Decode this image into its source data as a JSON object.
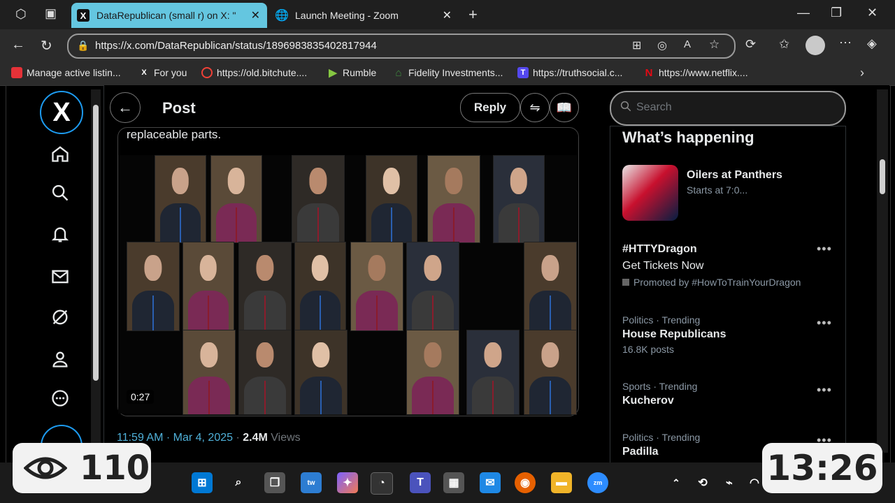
{
  "browser": {
    "tabs": [
      {
        "label": "DataRepublican (small r) on X: \"",
        "favicon": "X",
        "active": true
      },
      {
        "label": "Launch Meeting - Zoom",
        "favicon": "globe",
        "active": false
      }
    ],
    "url": "https://x.com/DataRepublican/status/1896983835402817944",
    "bookmarks": [
      {
        "label": "Manage active listin...",
        "icon": "ebay-icon",
        "color": "#e53238"
      },
      {
        "label": "For you",
        "icon": "x-icon",
        "color": "#000000"
      },
      {
        "label": "https://old.bitchute....",
        "icon": "bitchute-icon",
        "color": "#ef4137"
      },
      {
        "label": "Rumble",
        "icon": "rumble-icon",
        "color": "#85c742"
      },
      {
        "label": "Fidelity Investments...",
        "icon": "fidelity-icon",
        "color": "#3f8d3f"
      },
      {
        "label": "https://truthsocial.c...",
        "icon": "truthsocial-icon",
        "color": "#5448ee"
      },
      {
        "label": "https://www.netflix....",
        "icon": "netflix-icon",
        "color": "#e50914"
      }
    ]
  },
  "post": {
    "title": "Post",
    "reply_label": "Reply",
    "text": "replaceable parts.",
    "video_duration": "0:27",
    "time": "11:59 AM · Mar 4, 2025",
    "separator": " · ",
    "views": "2.4M",
    "views_label": "Views"
  },
  "sidebar": {
    "search_placeholder": "Search",
    "whats_happening": "What’s happening",
    "featured": {
      "title": "Oilers at Panthers",
      "sub": "Starts at 7:0..."
    },
    "promo": {
      "tag": "#HTTYDragon",
      "sub": "Get Tickets Now",
      "promoted": "Promoted by #HowToTrainYourDragon"
    },
    "trends": [
      {
        "category": "Politics · Trending",
        "name": "House Republicans",
        "count": "16.8K posts"
      },
      {
        "category": "Sports · Trending",
        "name": "Kucherov",
        "count": ""
      },
      {
        "category": "Politics · Trending",
        "name": "Padilla",
        "count": ""
      }
    ]
  },
  "overlay": {
    "views_count": "110",
    "clock": "13:26"
  }
}
